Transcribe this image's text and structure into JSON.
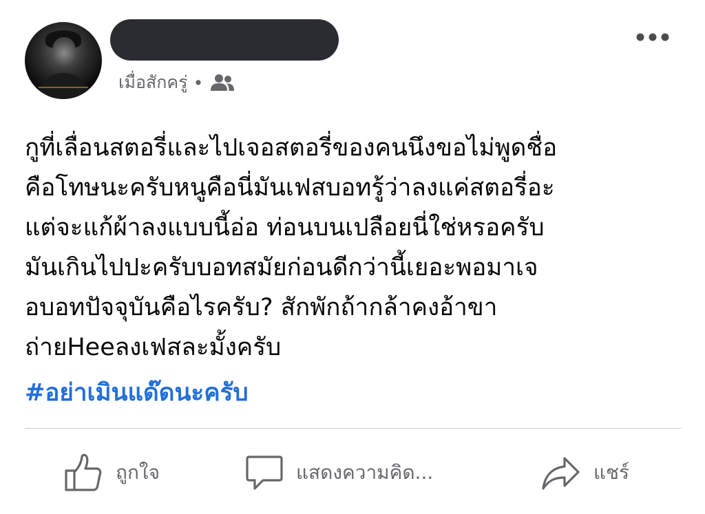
{
  "post": {
    "author_name": "",
    "timestamp": "เมื่อสักครู่",
    "separator": "•",
    "audience_icon": "friends-icon",
    "more_icon": "more-horizontal-icon",
    "text_lines": [
      "กูที่เลื่อนสตอรี่และไปเจอสตอรี่ของคนนึงขอไม่พูดชื่อ",
      "คือโทษนะครับหนูคือนี่มันเฟสบอทรู้ว่าลงแค่สตอรี่อะ",
      "แต่จะแก้ผ้าลงแบบนี้อ่อ ท่อนบนเปลือยนี่ใช่หรอครับ",
      "มันเกินไปปะครับบอทสมัยก่อนดีกว่านี้เยอะพอมาเจ",
      "อบอทปัจจุบันคือไรครับ? สักพักถ้ากล้าคงอ้าขา",
      "ถ่ายHeeลงเฟสละมั้งครับ"
    ],
    "hashtag": "#อย่าเมินแด๊ดนะครับ"
  },
  "actions": {
    "like": {
      "label": "ถูกใจ",
      "icon": "thumbs-up-icon"
    },
    "comment": {
      "label": "แสดงความคิด...",
      "icon": "comment-bubble-icon"
    },
    "share": {
      "label": "แชร์",
      "icon": "share-arrow-icon"
    }
  },
  "colors": {
    "text": "#050505",
    "secondary_text": "#65676b",
    "hashtag": "#216fdb",
    "redaction": "#2a2c31",
    "divider": "#ced0d4"
  }
}
